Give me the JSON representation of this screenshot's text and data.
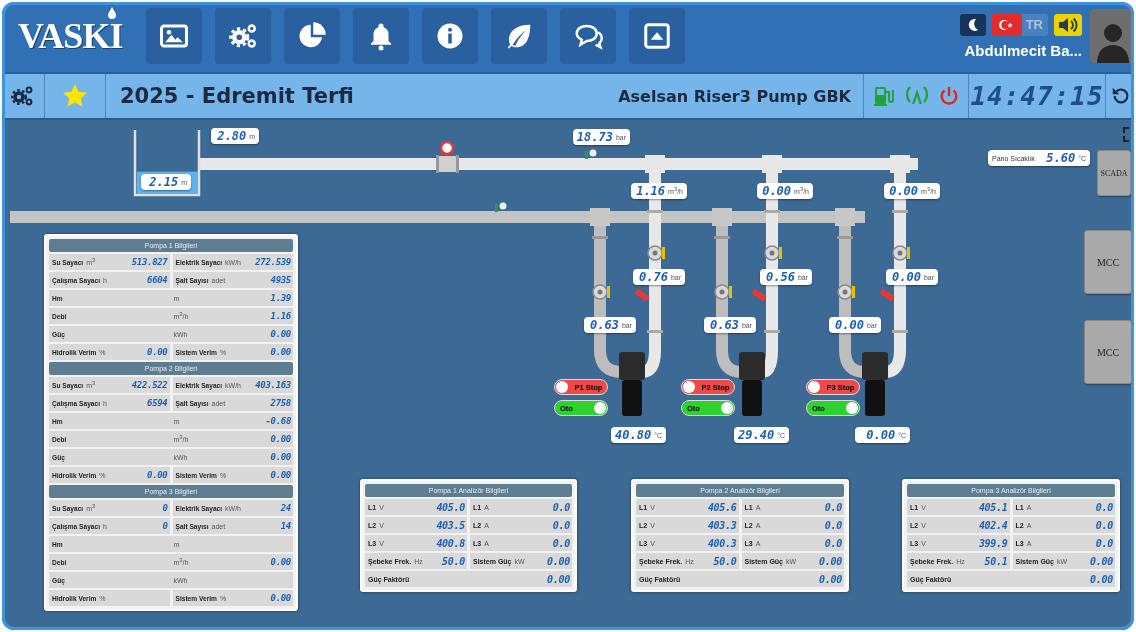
{
  "header": {
    "logo": "VASKI",
    "language": "TR",
    "user_name": "Abdulmecit Ba..."
  },
  "toolbar": {
    "title": "2025 - Edremit Terfi",
    "station": "Aselsan Riser3 Pump GBK",
    "clock": "14:47:15"
  },
  "diagram": {
    "tank": {
      "level": 0.36,
      "value": "2.15",
      "unit": "m"
    },
    "readings": [
      {
        "value": "2.80",
        "unit": "m"
      },
      {
        "value": "18.73",
        "unit": "bar"
      }
    ],
    "pumps": [
      {
        "flow": {
          "value": "1.16",
          "unit": "m$^{3}$/h"
        },
        "discharge_pressure": {
          "value": "0.76",
          "unit": "bar"
        },
        "suction_pressure": {
          "value": "0.63",
          "unit": "bar"
        },
        "temperature": {
          "value": "40.80",
          "unit": "°C"
        },
        "stop_switch": {
          "label": "P1 Stop",
          "on": false
        },
        "mode_switch": {
          "label": "Oto",
          "on": true
        }
      },
      {
        "flow": {
          "value": "0.00",
          "unit": "m$^{3}$/h"
        },
        "discharge_pressure": {
          "value": "0.56",
          "unit": "bar"
        },
        "suction_pressure": {
          "value": "0.63",
          "unit": "bar"
        },
        "temperature": {
          "value": "29.40",
          "unit": "°C"
        },
        "stop_switch": {
          "label": "P2 Stop",
          "on": false
        },
        "mode_switch": {
          "label": "Oto",
          "on": true
        }
      },
      {
        "flow": {
          "value": "0.00",
          "unit": "m$^{3}$/h"
        },
        "discharge_pressure": {
          "value": "0.00",
          "unit": "bar"
        },
        "suction_pressure": {
          "value": "0.00",
          "unit": "bar"
        },
        "temperature": {
          "value": "0.00",
          "unit": "°C"
        },
        "stop_switch": {
          "label": "P3 Stop",
          "on": false
        },
        "mode_switch": {
          "label": "Oto",
          "on": true
        }
      }
    ],
    "panel_temperature": {
      "label": "Pano Sıcaklık",
      "value": "5.60",
      "unit": "°C"
    },
    "side_buttons": [
      "SCADA",
      "MCC",
      "MCC"
    ]
  },
  "pump_panels": [
    {
      "title": "Pompa 1 Bilgileri",
      "rows": [
        {
          "kind": "pair",
          "cells": [
            {
              "label": "Su Sayacı",
              "unit": "m$^{3}$",
              "value": "513.827"
            },
            {
              "label": "Elektrik Sayacı",
              "unit": "kW/h",
              "value": "272.539"
            }
          ]
        },
        {
          "kind": "pair",
          "cells": [
            {
              "label": "Çalışma Sayacı",
              "unit": "h",
              "value": "6604"
            },
            {
              "label": "Şalt Sayısı",
              "unit": "adet",
              "value": "4935"
            }
          ]
        },
        {
          "kind": "single",
          "cells": [
            {
              "label": "Hm",
              "unit": "m",
              "value": "1.39"
            }
          ]
        },
        {
          "kind": "single",
          "cells": [
            {
              "label": "Debi",
              "unit": "m$^{3}$/h",
              "value": "1.16"
            }
          ]
        },
        {
          "kind": "single",
          "cells": [
            {
              "label": "Güç",
              "unit": "kWh",
              "value": "0.00"
            }
          ]
        },
        {
          "kind": "pair",
          "cells": [
            {
              "label": "Hidrolik Verim",
              "unit": "%",
              "value": "0.00"
            },
            {
              "label": "Sistem Verim",
              "unit": "%",
              "value": "0.00"
            }
          ]
        }
      ]
    },
    {
      "title": "Pompa 2 Bilgileri",
      "rows": [
        {
          "kind": "pair",
          "cells": [
            {
              "label": "Su Sayacı",
              "unit": "m$^{3}$",
              "value": "422.522"
            },
            {
              "label": "Elektrik Sayacı",
              "unit": "kW/h",
              "value": "403.163"
            }
          ]
        },
        {
          "kind": "pair",
          "cells": [
            {
              "label": "Çalışma Sayacı",
              "unit": "h",
              "value": "6594"
            },
            {
              "label": "Şalt Sayısı",
              "unit": "adet",
              "value": "2758"
            }
          ]
        },
        {
          "kind": "single",
          "cells": [
            {
              "label": "Hm",
              "unit": "m",
              "value": "-0.68"
            }
          ]
        },
        {
          "kind": "single",
          "cells": [
            {
              "label": "Debi",
              "unit": "m$^{3}$/h",
              "value": "0.00"
            }
          ]
        },
        {
          "kind": "single",
          "cells": [
            {
              "label": "Güç",
              "unit": "kWh",
              "value": "0.00"
            }
          ]
        },
        {
          "kind": "pair",
          "cells": [
            {
              "label": "Hidrolik Verim",
              "unit": "%",
              "value": "0.00"
            },
            {
              "label": "Sistem Verim",
              "unit": "%",
              "value": "0.00"
            }
          ]
        }
      ]
    },
    {
      "title": "Pompa 3 Bilgileri",
      "rows": [
        {
          "kind": "pair",
          "cells": [
            {
              "label": "Su Sayacı",
              "unit": "m$^{3}$",
              "value": "0"
            },
            {
              "label": "Elektrik Sayacı",
              "unit": "kW/h",
              "value": "24"
            }
          ]
        },
        {
          "kind": "pair",
          "cells": [
            {
              "label": "Çalışma Sayacı",
              "unit": "h",
              "value": "0"
            },
            {
              "label": "Şalt Sayısı",
              "unit": "adet",
              "value": "14"
            }
          ]
        },
        {
          "kind": "single",
          "cells": [
            {
              "label": "Hm",
              "unit": "m"
            }
          ]
        },
        {
          "kind": "single",
          "cells": [
            {
              "label": "Debi",
              "unit": "m$^{3}$/h",
              "value": "0.00"
            }
          ]
        },
        {
          "kind": "single",
          "cells": [
            {
              "label": "Güç",
              "unit": "kWh"
            }
          ]
        },
        {
          "kind": "pair",
          "cells": [
            {
              "label": "Hidrolik Verim",
              "unit": "%"
            },
            {
              "label": "Sistem Verim",
              "unit": "%",
              "value": "0.00"
            }
          ]
        }
      ]
    }
  ],
  "analyzer_panels": [
    {
      "title": "Pompa 1 Analizör Bilgileri",
      "rows": [
        {
          "kind": "pair",
          "cells": [
            {
              "label": "L1",
              "unit": "V",
              "value": "405.0"
            },
            {
              "label": "L1",
              "unit": "A",
              "value": "0.0"
            }
          ]
        },
        {
          "kind": "pair",
          "cells": [
            {
              "label": "L2",
              "unit": "V",
              "value": "403.5"
            },
            {
              "label": "L2",
              "unit": "A",
              "value": "0.0"
            }
          ]
        },
        {
          "kind": "pair",
          "cells": [
            {
              "label": "L3",
              "unit": "V",
              "value": "400.8"
            },
            {
              "label": "L3",
              "unit": "A",
              "value": "0.0"
            }
          ]
        },
        {
          "kind": "pair",
          "cells": [
            {
              "label": "Şebeke Frek.",
              "unit": "Hz",
              "value": "50.0"
            },
            {
              "label": "Sistem Güç",
              "unit": "kW",
              "value": "0.00"
            }
          ]
        },
        {
          "kind": "single",
          "cells": [
            {
              "label": "Güç Faktörü",
              "value": "0.00"
            }
          ]
        }
      ]
    },
    {
      "title": "Pompa 2 Analizör Bilgileri",
      "rows": [
        {
          "kind": "pair",
          "cells": [
            {
              "label": "L1",
              "unit": "V",
              "value": "405.6"
            },
            {
              "label": "L1",
              "unit": "A",
              "value": "0.0"
            }
          ]
        },
        {
          "kind": "pair",
          "cells": [
            {
              "label": "L2",
              "unit": "V",
              "value": "403.3"
            },
            {
              "label": "L2",
              "unit": "A",
              "value": "0.0"
            }
          ]
        },
        {
          "kind": "pair",
          "cells": [
            {
              "label": "L3",
              "unit": "V",
              "value": "400.3"
            },
            {
              "label": "L3",
              "unit": "A",
              "value": "0.0"
            }
          ]
        },
        {
          "kind": "pair",
          "cells": [
            {
              "label": "Şebeke Frek.",
              "unit": "Hz",
              "value": "50.0"
            },
            {
              "label": "Sistem Güç",
              "unit": "kW",
              "value": "0.00"
            }
          ]
        },
        {
          "kind": "single",
          "cells": [
            {
              "label": "Güç Faktörü",
              "value": "0.00"
            }
          ]
        }
      ]
    },
    {
      "title": "Pompa 3 Analizör Bilgileri",
      "rows": [
        {
          "kind": "pair",
          "cells": [
            {
              "label": "L1",
              "unit": "V",
              "value": "405.1"
            },
            {
              "label": "L1",
              "unit": "A",
              "value": "0.0"
            }
          ]
        },
        {
          "kind": "pair",
          "cells": [
            {
              "label": "L2",
              "unit": "V",
              "value": "402.4"
            },
            {
              "label": "L2",
              "unit": "A",
              "value": "0.0"
            }
          ]
        },
        {
          "kind": "pair",
          "cells": [
            {
              "label": "L3",
              "unit": "V",
              "value": "399.9"
            },
            {
              "label": "L3",
              "unit": "A",
              "value": "0.0"
            }
          ]
        },
        {
          "kind": "pair",
          "cells": [
            {
              "label": "Şebeke Frek.",
              "unit": "Hz",
              "value": "50.1"
            },
            {
              "label": "Sistem Güç",
              "unit": "kW",
              "value": "0.00"
            }
          ]
        },
        {
          "kind": "single",
          "cells": [
            {
              "label": "Güç Faktörü",
              "value": "0.00"
            }
          ]
        }
      ]
    }
  ]
}
